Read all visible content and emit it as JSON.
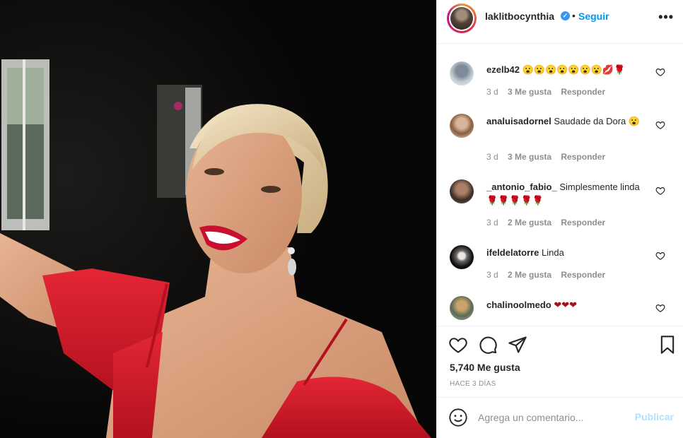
{
  "post": {
    "username": "laklitbocynthia",
    "verified_icon": "verified-badge-icon",
    "separator": "•",
    "follow_label": "Seguir",
    "more_label": "•••"
  },
  "comments": [
    {
      "user": "ezelb42",
      "text": "😮😮😮😮😮😮😮💋🌹",
      "age": "3 d",
      "likes": "3 Me gusta",
      "reply": "Responder"
    },
    {
      "user": "analuisadornel",
      "text": "Saudade da Dora 😮",
      "age": "3 d",
      "likes": "3 Me gusta",
      "reply": "Responder"
    },
    {
      "user": "_antonio_fabio_",
      "text": "Simplesmente linda 🌹🌹🌹🌹🌹",
      "age": "3 d",
      "likes": "2 Me gusta",
      "reply": "Responder"
    },
    {
      "user": "ifeldelatorre",
      "text": "Linda",
      "age": "3 d",
      "likes": "2 Me gusta",
      "reply": "Responder"
    },
    {
      "user": "chalinoolmedo",
      "text": "❤❤❤",
      "age": "",
      "likes": "",
      "reply": ""
    }
  ],
  "actions": {
    "likes_count": "5,740 Me gusta",
    "timestamp": "HACE 3 DÍAS",
    "icons": [
      "heart-icon",
      "comment-icon",
      "share-icon",
      "bookmark-icon"
    ]
  },
  "composer": {
    "placeholder": "Agrega un comentario...",
    "publish_label": "Publicar",
    "emoji_icon": "emoji-icon"
  },
  "colors": {
    "link_blue": "#0095f6",
    "publish_disabled": "#b2dffc",
    "muted": "#8e8e8e",
    "dress_red": "#d81b2a"
  }
}
